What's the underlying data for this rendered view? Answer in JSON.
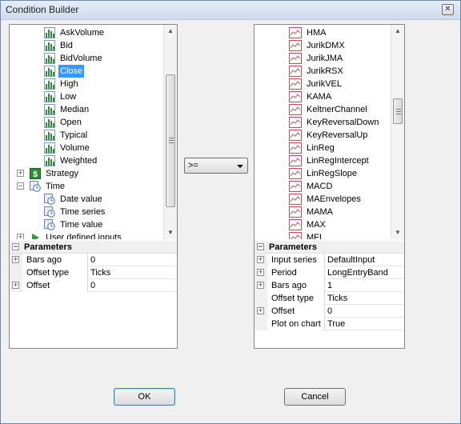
{
  "window": {
    "title": "Condition Builder"
  },
  "left": {
    "tree": [
      {
        "label": "AskVolume",
        "icon": "bar-chart-icon"
      },
      {
        "label": "Bid",
        "icon": "bar-chart-icon"
      },
      {
        "label": "BidVolume",
        "icon": "bar-chart-icon"
      },
      {
        "label": "Close",
        "icon": "bar-chart-icon",
        "selected": true
      },
      {
        "label": "High",
        "icon": "bar-chart-icon"
      },
      {
        "label": "Low",
        "icon": "bar-chart-icon"
      },
      {
        "label": "Median",
        "icon": "bar-chart-icon"
      },
      {
        "label": "Open",
        "icon": "bar-chart-icon"
      },
      {
        "label": "Typical",
        "icon": "bar-chart-icon"
      },
      {
        "label": "Volume",
        "icon": "bar-chart-icon"
      },
      {
        "label": "Weighted",
        "icon": "bar-chart-icon"
      },
      {
        "label": "Strategy",
        "icon": "dollar-icon",
        "expander": "+"
      },
      {
        "label": "Time",
        "icon": "clock-icon",
        "expander": "−"
      },
      {
        "label": "Date value",
        "icon": "clock-icon"
      },
      {
        "label": "Time series",
        "icon": "clock-icon"
      },
      {
        "label": "Time value",
        "icon": "clock-icon"
      },
      {
        "label": "User defined inputs",
        "icon": "play-arrow-icon",
        "expander": "+"
      }
    ],
    "params_title": "Parameters",
    "params": [
      {
        "name": "Bars ago",
        "value": "0",
        "expander": "+"
      },
      {
        "name": "Offset type",
        "value": "Ticks"
      },
      {
        "name": "Offset",
        "value": "0",
        "expander": "+"
      }
    ]
  },
  "operator": {
    "value": ">="
  },
  "right": {
    "tree": [
      {
        "label": "HMA"
      },
      {
        "label": "JurikDMX"
      },
      {
        "label": "JurikJMA"
      },
      {
        "label": "JurikRSX"
      },
      {
        "label": "JurikVEL"
      },
      {
        "label": "KAMA"
      },
      {
        "label": "KeltnerChannel"
      },
      {
        "label": "KeyReversalDown"
      },
      {
        "label": "KeyReversalUp"
      },
      {
        "label": "LinReg"
      },
      {
        "label": "LinRegIntercept"
      },
      {
        "label": "LinRegSlope"
      },
      {
        "label": "MACD"
      },
      {
        "label": "MAEnvelopes"
      },
      {
        "label": "MAMA"
      },
      {
        "label": "MAX"
      },
      {
        "label": "MFI"
      }
    ],
    "params_title": "Parameters",
    "params": [
      {
        "name": "Input series",
        "value": "DefaultInput",
        "expander": "+"
      },
      {
        "name": "Period",
        "value": "LongEntryBand",
        "expander": "+"
      },
      {
        "name": "Bars ago",
        "value": "1",
        "expander": "+"
      },
      {
        "name": "Offset type",
        "value": "Ticks"
      },
      {
        "name": "Offset",
        "value": "0",
        "expander": "+"
      },
      {
        "name": "Plot on chart",
        "value": "True"
      }
    ]
  },
  "buttons": {
    "ok": "OK",
    "cancel": "Cancel"
  },
  "colors": {
    "selection": "#3399ff",
    "bar_icon": "#2e8b3a",
    "indicator_icon_border": "#c0504d"
  }
}
